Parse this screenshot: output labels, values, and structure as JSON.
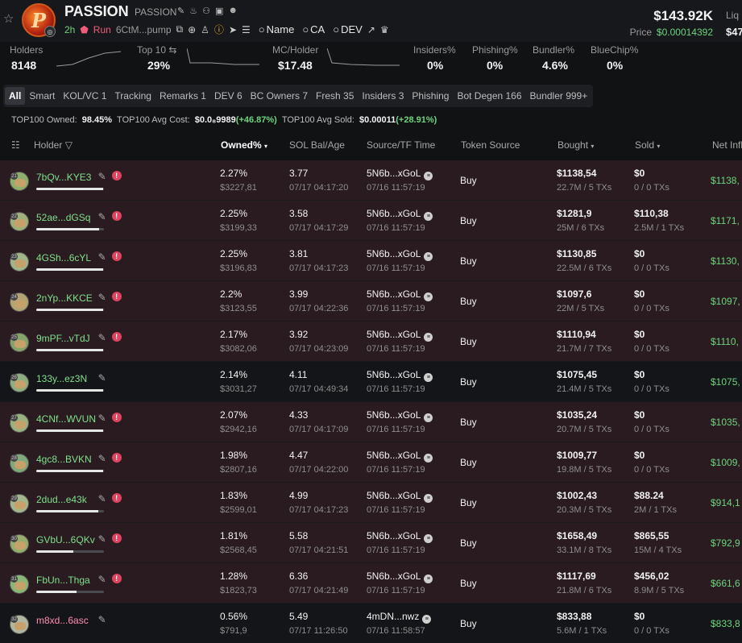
{
  "token": {
    "name": "PASSION",
    "ticker": "PASSION",
    "logo_letter": "P",
    "age": "2h",
    "run_label": "Run",
    "contract": "6CtM...pump",
    "search_items": [
      "Name",
      "CA",
      "DEV"
    ]
  },
  "market": {
    "market_cap": "$143.92K",
    "price_label": "Price",
    "price": "$0.00014392",
    "liq_label": "Liq",
    "liq_value": "$47"
  },
  "stats": [
    {
      "label": "Holders",
      "value": "8148"
    },
    {
      "label": "Top 10",
      "value": "29%"
    },
    {
      "label": "MC/Holder",
      "value": "$17.48"
    },
    {
      "label": "Insiders%",
      "value": "0%"
    },
    {
      "label": "Phishing%",
      "value": "0%"
    },
    {
      "label": "Bundler%",
      "value": "4.6%"
    },
    {
      "label": "BlueChip%",
      "value": "0%"
    }
  ],
  "tabs": [
    "All",
    "Smart",
    "KOL/VC 1",
    "Tracking",
    "Remarks 1",
    "DEV 6",
    "BC Owners 7",
    "Fresh 35",
    "Insiders 3",
    "Phishing",
    "Bot Degen 166",
    "Bundler 999+"
  ],
  "summary": {
    "owned_label": "TOP100 Owned:",
    "owned_value": "98.45%",
    "cost_label": "TOP100 Avg Cost:",
    "cost_value": "$0.0₈9989",
    "cost_change": "(+46.87%)",
    "sold_label": "TOP100 Avg Sold:",
    "sold_value": "$0.00011",
    "sold_change": "(+28.91%)"
  },
  "columns": {
    "holder": "Holder",
    "owned": "Owned%",
    "sol": "SOL Bal/Age",
    "source": "Source/TF Time",
    "token_source": "Token Source",
    "bought": "Bought",
    "sold": "Sold",
    "net": "Net Infl"
  },
  "rows": [
    {
      "rank": "21",
      "addr": "7bQv...KYE3",
      "flag": true,
      "bar": 0.99,
      "owned": "2.27%",
      "owned_usd": "$3227,81",
      "sol": "3.77",
      "sol_age": "07/17 04:17:20",
      "src": "5N6b...xGoL",
      "src_time": "07/16 11:57:19",
      "token_src": "Buy",
      "bought": "$1138,54",
      "bought_sub": "22.7M / 5 TXs",
      "sold": "$0",
      "sold_sub": "0 / 0 TXs",
      "net": "$1138,"
    },
    {
      "rank": "22",
      "addr": "52ae...dGSq",
      "flag": true,
      "bar": 0.93,
      "owned": "2.25%",
      "owned_usd": "$3199,33",
      "sol": "3.58",
      "sol_age": "07/17 04:17:29",
      "src": "5N6b...xGoL",
      "src_time": "07/16 11:57:19",
      "token_src": "Buy",
      "bought": "$1281,9",
      "bought_sub": "25M / 6 TXs",
      "sold": "$110,38",
      "sold_sub": "2.5M / 1 TXs",
      "net": "$1171,"
    },
    {
      "rank": "23",
      "addr": "4GSh...6cYL",
      "flag": true,
      "bar": 0.99,
      "owned": "2.25%",
      "owned_usd": "$3196,83",
      "sol": "3.81",
      "sol_age": "07/17 04:17:23",
      "src": "5N6b...xGoL",
      "src_time": "07/16 11:57:19",
      "token_src": "Buy",
      "bought": "$1130,85",
      "bought_sub": "22.5M / 6 TXs",
      "sold": "$0",
      "sold_sub": "0 / 0 TXs",
      "net": "$1130,"
    },
    {
      "rank": "24",
      "addr": "2nYp...KKCE",
      "flag": true,
      "bar": 0.99,
      "owned": "2.2%",
      "owned_usd": "$3123,55",
      "sol": "3.99",
      "sol_age": "07/17 04:22:36",
      "src": "5N6b...xGoL",
      "src_time": "07/16 11:57:19",
      "token_src": "Buy",
      "bought": "$1097,6",
      "bought_sub": "22M / 5 TXs",
      "sold": "$0",
      "sold_sub": "0 / 0 TXs",
      "net": "$1097,"
    },
    {
      "rank": "25",
      "addr": "9mPF...vTdJ",
      "flag": true,
      "bar": 0.99,
      "owned": "2.17%",
      "owned_usd": "$3082,06",
      "sol": "3.92",
      "sol_age": "07/17 04:23:09",
      "src": "5N6b...xGoL",
      "src_time": "07/16 11:57:19",
      "token_src": "Buy",
      "bought": "$1110,94",
      "bought_sub": "21.7M / 7 TXs",
      "sold": "$0",
      "sold_sub": "0 / 0 TXs",
      "net": "$1110,"
    },
    {
      "rank": "26",
      "addr": "133y...ez3N",
      "flag": false,
      "bar": 0.99,
      "owned": "2.14%",
      "owned_usd": "$3031,27",
      "sol": "4.11",
      "sol_age": "07/17 04:49:34",
      "src": "5N6b...xGoL",
      "src_time": "07/16 11:57:19",
      "token_src": "Buy",
      "bought": "$1075,45",
      "bought_sub": "21.4M / 5 TXs",
      "sold": "$0",
      "sold_sub": "0 / 0 TXs",
      "net": "$1075,"
    },
    {
      "rank": "27",
      "addr": "4CNf...WVUN",
      "flag": true,
      "bar": 0.99,
      "owned": "2.07%",
      "owned_usd": "$2942,16",
      "sol": "4.33",
      "sol_age": "07/17 04:17:09",
      "src": "5N6b...xGoL",
      "src_time": "07/16 11:57:19",
      "token_src": "Buy",
      "bought": "$1035,24",
      "bought_sub": "20.7M / 5 TXs",
      "sold": "$0",
      "sold_sub": "0 / 0 TXs",
      "net": "$1035,"
    },
    {
      "rank": "28",
      "addr": "4gc8...BVKN",
      "flag": true,
      "bar": 0.99,
      "owned": "1.98%",
      "owned_usd": "$2807,16",
      "sol": "4.47",
      "sol_age": "07/17 04:22:00",
      "src": "5N6b...xGoL",
      "src_time": "07/16 11:57:19",
      "token_src": "Buy",
      "bought": "$1009,77",
      "bought_sub": "19.8M / 5 TXs",
      "sold": "$0",
      "sold_sub": "0 / 0 TXs",
      "net": "$1009,"
    },
    {
      "rank": "29",
      "addr": "2dud...e43k",
      "flag": true,
      "bar": 0.92,
      "owned": "1.83%",
      "owned_usd": "$2599,01",
      "sol": "4.99",
      "sol_age": "07/17 04:17:23",
      "src": "5N6b...xGoL",
      "src_time": "07/16 11:57:19",
      "token_src": "Buy",
      "bought": "$1002,43",
      "bought_sub": "20.3M / 5 TXs",
      "sold": "$88.24",
      "sold_sub": "2M / 1 TXs",
      "net": "$914,1"
    },
    {
      "rank": "30",
      "addr": "GVbU...6QKv",
      "flag": true,
      "bar": 0.55,
      "owned": "1.81%",
      "owned_usd": "$2568,45",
      "sol": "5.58",
      "sol_age": "07/17 04:21:51",
      "src": "5N6b...xGoL",
      "src_time": "07/16 11:57:19",
      "token_src": "Buy",
      "bought": "$1658,49",
      "bought_sub": "33.1M / 8 TXs",
      "sold": "$865,55",
      "sold_sub": "15M / 4 TXs",
      "net": "$792,9"
    },
    {
      "rank": "31",
      "addr": "FbUn...Thga",
      "flag": true,
      "bar": 0.6,
      "owned": "1.28%",
      "owned_usd": "$1823,73",
      "sol": "6.36",
      "sol_age": "07/17 04:21:49",
      "src": "5N6b...xGoL",
      "src_time": "07/16 11:57:19",
      "token_src": "Buy",
      "bought": "$1117,69",
      "bought_sub": "21.8M / 6 TXs",
      "sold": "$456,02",
      "sold_sub": "8.9M / 5 TXs",
      "net": "$661,6"
    },
    {
      "rank": "32",
      "addr": "m8xd...6asc",
      "flag": false,
      "pink": true,
      "bar": 0,
      "owned": "0.56%",
      "owned_usd": "$791,9",
      "sol": "5.49",
      "sol_age": "07/17 11:26:50",
      "src": "4mDN...nwz",
      "src_time": "07/16 11:58:57",
      "token_src": "Buy",
      "bought": "$833,88",
      "bought_sub": "5.6M / 1 TXs",
      "sold": "$0",
      "sold_sub": "0 / 0 TXs",
      "net": "$833,8"
    }
  ],
  "colors": {
    "green": "#6dd47e",
    "pink": "#ff8fb0",
    "warn": "#e0435f",
    "flag_row": "#2a1b21"
  }
}
